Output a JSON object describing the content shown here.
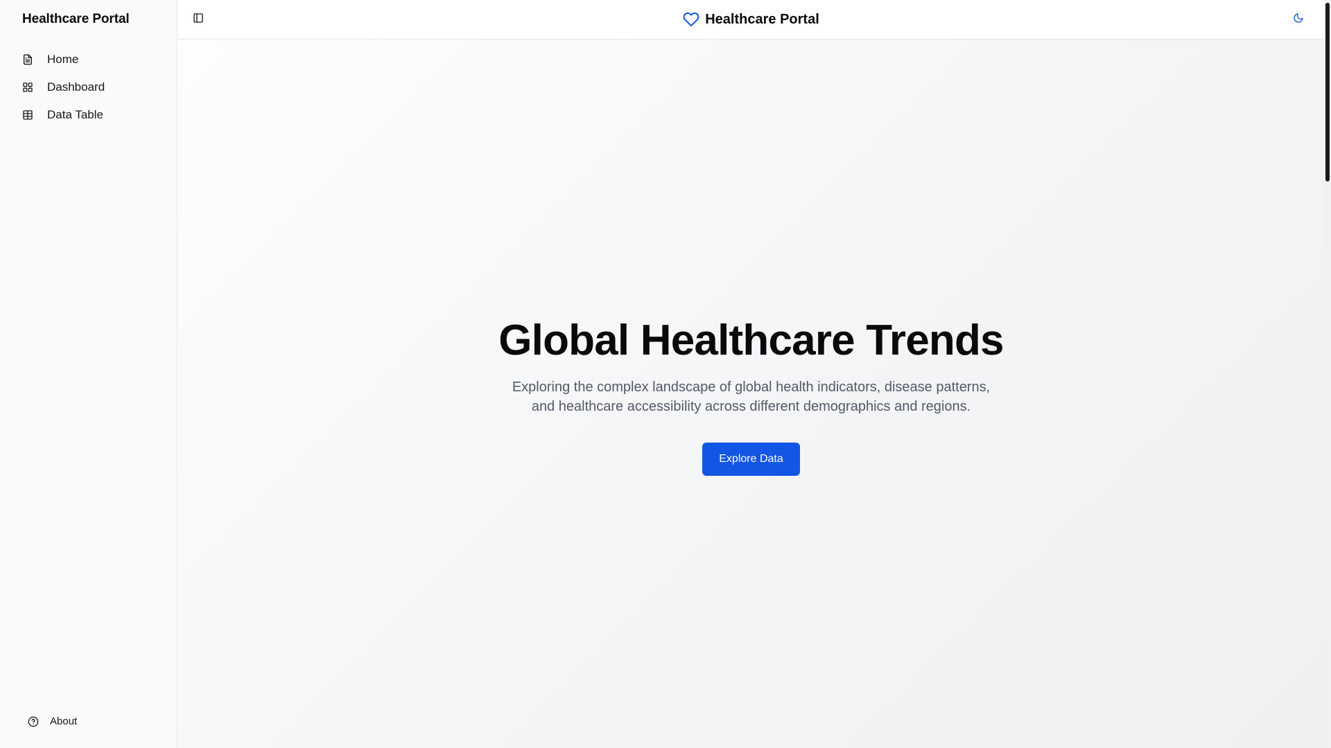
{
  "sidebar": {
    "title": "Healthcare Portal",
    "items": [
      {
        "label": "Home",
        "icon": "file-text-icon"
      },
      {
        "label": "Dashboard",
        "icon": "grid-icon"
      },
      {
        "label": "Data Table",
        "icon": "table-icon"
      }
    ],
    "footer": {
      "label": "About",
      "icon": "help-circle-icon"
    }
  },
  "header": {
    "brand": "Healthcare Portal",
    "brand_icon": "heart-icon",
    "toggle_icon": "sidebar-toggle-icon",
    "theme_icon": "moon-icon"
  },
  "hero": {
    "title": "Global Healthcare Trends",
    "subtitle_line1": "Exploring the complex landscape of global health indicators, disease patterns,",
    "subtitle_line2": "and healthcare accessibility across different demographics and regions.",
    "cta_label": "Explore Data"
  },
  "colors": {
    "accent": "#1356e3",
    "text": "#0a0a0a",
    "muted": "#525866"
  }
}
